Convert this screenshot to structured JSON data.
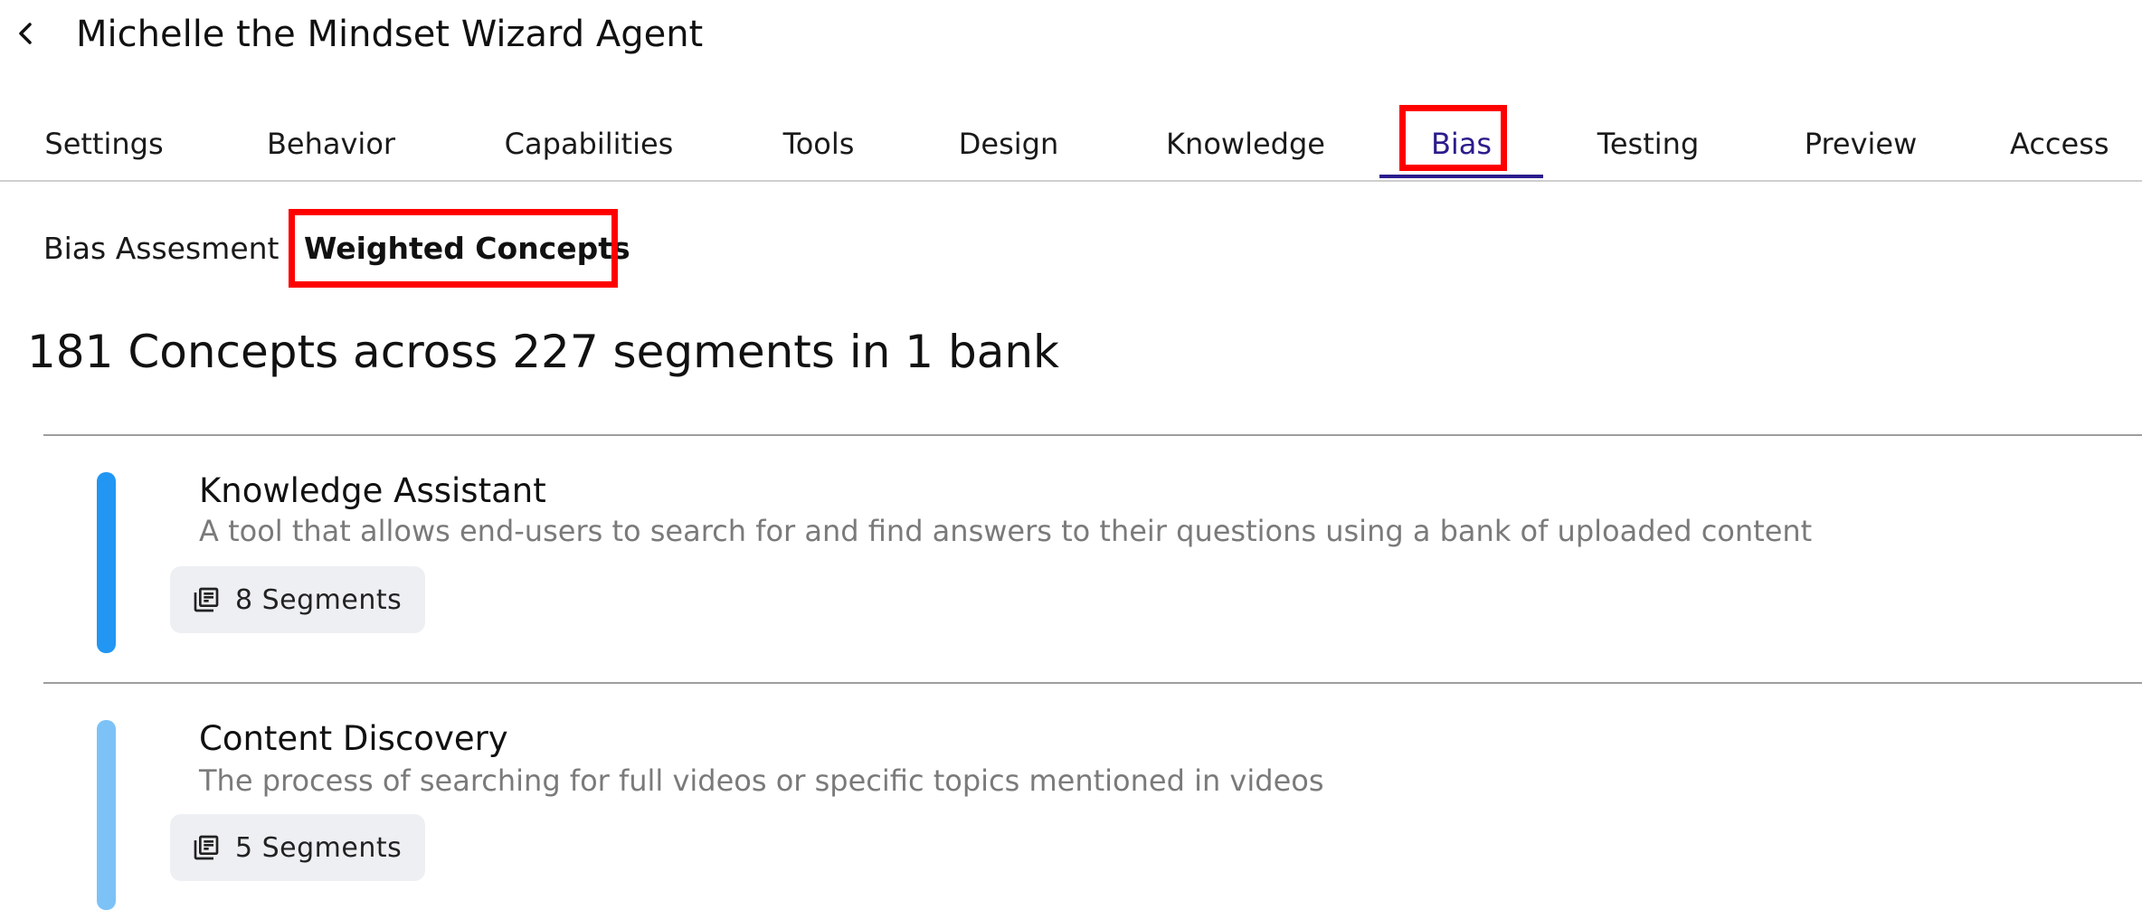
{
  "header": {
    "back_icon": "chevron-left-icon",
    "title": "Michelle the Mindset Wizard Agent"
  },
  "tabs": [
    {
      "label": "Settings",
      "active": false
    },
    {
      "label": "Behavior",
      "active": false
    },
    {
      "label": "Capabilities",
      "active": false
    },
    {
      "label": "Tools",
      "active": false
    },
    {
      "label": "Design",
      "active": false
    },
    {
      "label": "Knowledge",
      "active": false
    },
    {
      "label": "Bias",
      "active": true
    },
    {
      "label": "Testing",
      "active": false
    },
    {
      "label": "Preview",
      "active": false
    },
    {
      "label": "Access",
      "active": false
    }
  ],
  "subtabs": [
    {
      "label": "Bias Assesment",
      "active": false
    },
    {
      "label": "Weighted Concepts",
      "active": true
    }
  ],
  "summary": "181 Concepts across 227 segments in 1 bank",
  "concepts": [
    {
      "name": "Knowledge Assistant",
      "description": "A tool that allows end-users to search for and find answers to their questions using a bank of uploaded content",
      "segments_label": "8 Segments",
      "accent_color": "#2196f3"
    },
    {
      "name": "Content Discovery",
      "description": "The process of searching for full videos or specific topics mentioned in videos",
      "segments_label": "5 Segments",
      "accent_color": "#7cc2f7"
    }
  ],
  "colors": {
    "active_tab": "#2b1c8c",
    "highlight": "#ff0000",
    "chip_background": "#eeeff3"
  },
  "icons": {
    "segment_icon": "library-books-icon"
  }
}
